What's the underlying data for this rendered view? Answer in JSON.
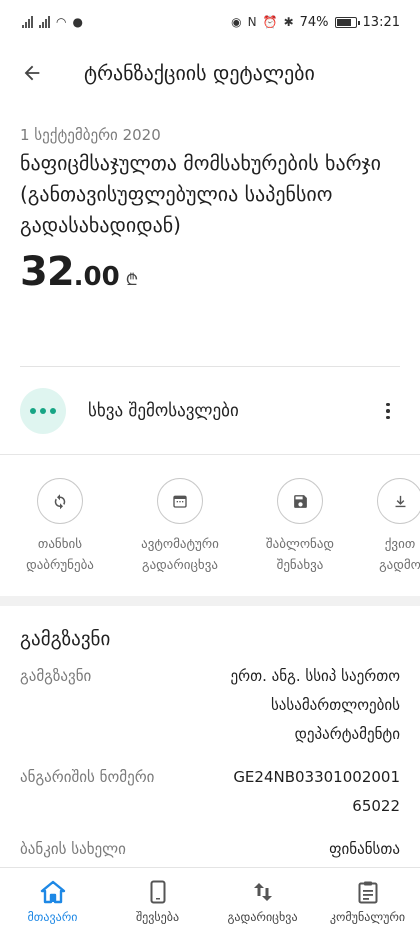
{
  "status_bar": {
    "battery": "74%",
    "time": "13:21"
  },
  "header": {
    "title": "ტრანზაქციის დეტალები",
    "back_icon": "arrow-left-icon"
  },
  "transaction": {
    "date": "1 სექტემბერი 2020",
    "description": "ნაფიცმსაჯულთა მომსახურების ხარჯი (განთავისუფლებულია საპენსიო გადასახადიდან)",
    "amount_int": "32",
    "amount_dec": ".00",
    "currency": "₾"
  },
  "category": {
    "label": "სხვა შემოსავლები",
    "icon": "dots-icon",
    "icon_color": "#17a585",
    "icon_bg": "#dff5f0"
  },
  "actions": [
    {
      "label": "თანხის\nდაბრუნება",
      "icon": "refresh-icon"
    },
    {
      "label": "ავტომატური\nგადარიცხვა",
      "icon": "calendar-icon"
    },
    {
      "label": "შაბლონად\nშენახვა",
      "icon": "save-icon"
    },
    {
      "label": "ქვით\nგადმო",
      "icon": "download-icon"
    }
  ],
  "sender": {
    "title": "გამგზავნი",
    "rows": [
      {
        "label": "გამგზავნი",
        "value": "ერთ. ანგ. სსიპ საერთო\nსასამართლოების\nდეპარტამენტი"
      },
      {
        "label": "ანგარიშის ნომერი",
        "value": "GE24NB03301002001\n65022"
      },
      {
        "label": "ბანკის სახელი",
        "value": "ფინანსთა\nსამინისტროს"
      }
    ]
  },
  "bottom_nav": [
    {
      "label": "მთავარი",
      "icon": "home-icon",
      "active": true
    },
    {
      "label": "შევსება",
      "icon": "phone-icon",
      "active": false
    },
    {
      "label": "გადარიცხვა",
      "icon": "transfer-arrows-icon",
      "active": false
    },
    {
      "label": "კომუნალური",
      "icon": "clipboard-icon",
      "active": false
    }
  ],
  "colors": {
    "accent": "#1e88e5",
    "teal": "#17a585"
  }
}
